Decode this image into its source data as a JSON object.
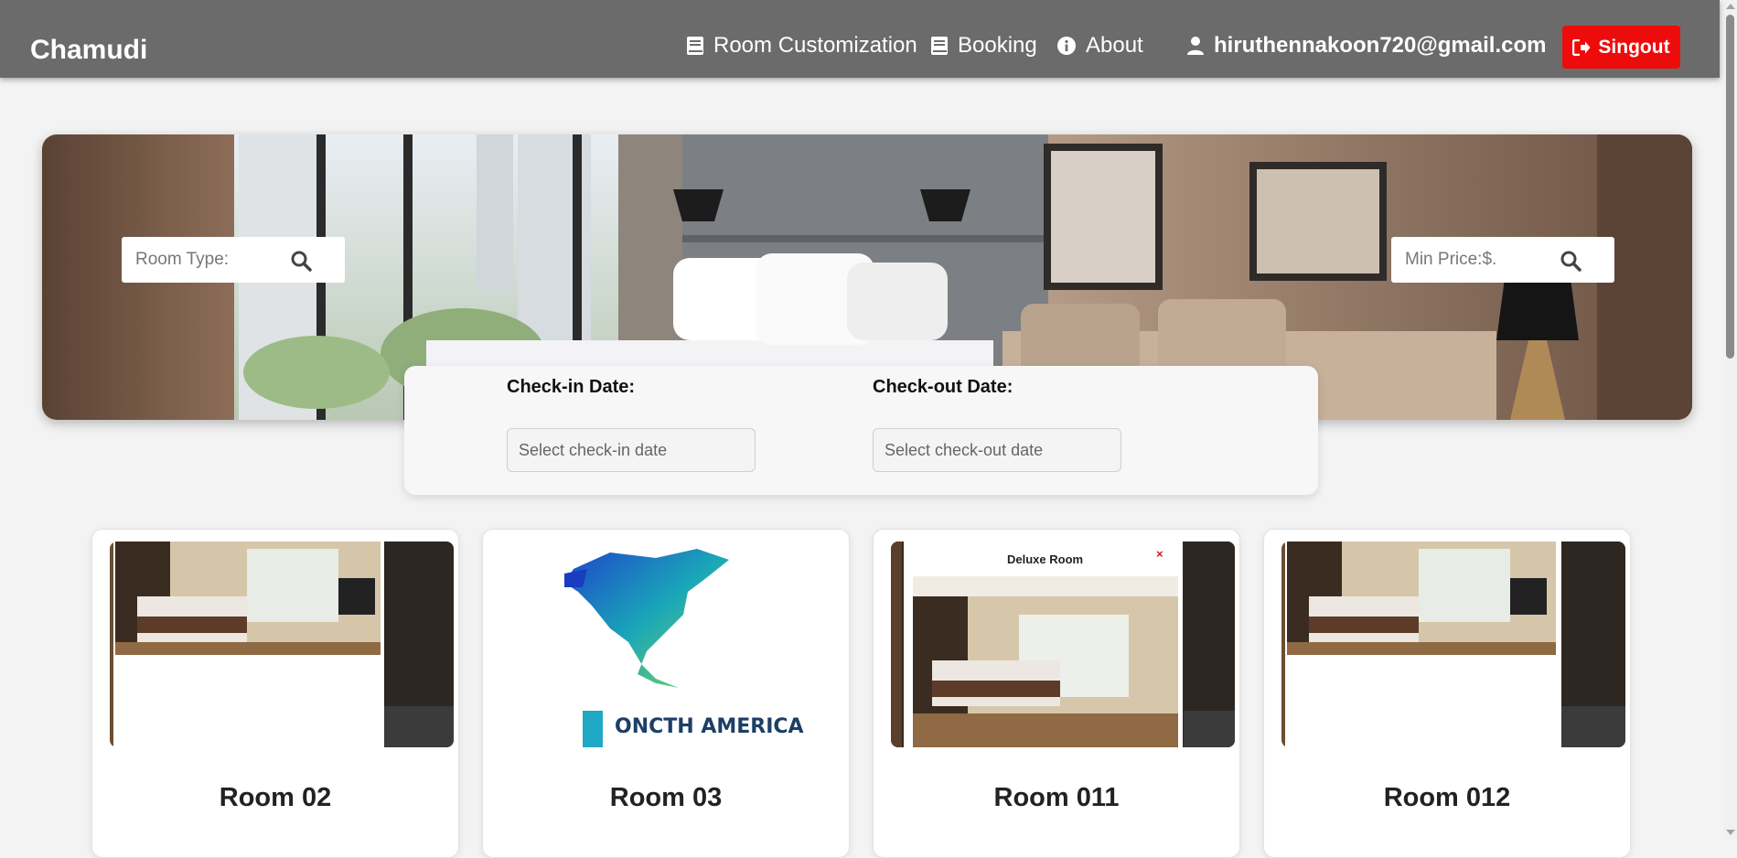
{
  "navbar": {
    "brand": "Chamudi",
    "links": [
      {
        "label": "Room Customization",
        "icon": "book-icon"
      },
      {
        "label": "Booking",
        "icon": "book-icon"
      },
      {
        "label": "About",
        "icon": "info-icon"
      }
    ],
    "user_email": "hiruthennakoon720@gmail.com",
    "user_icon": "user-icon",
    "signout_label": "Singout",
    "signout_icon": "sign-out-icon"
  },
  "hero": {
    "room_type_placeholder": "Room Type:",
    "min_price_placeholder": "Min Price:$.",
    "search_icon": "search-icon"
  },
  "dates": {
    "checkin_label": "Check-in Date:",
    "checkin_placeholder": "Select check-in date",
    "checkout_label": "Check-out Date:",
    "checkout_placeholder": "Select check-out date"
  },
  "rooms": [
    {
      "title": "Room 02"
    },
    {
      "title": "Room 03",
      "image_text": "ONCTH AMERICA"
    },
    {
      "title": "Room 011",
      "image_caption": "Deluxe Room",
      "image_close": "×"
    },
    {
      "title": "Room 012"
    }
  ],
  "colors": {
    "navbar_bg": "#6b6b6b",
    "signout_bg": "#ee0b0b",
    "page_bg": "#f3f3f3"
  }
}
